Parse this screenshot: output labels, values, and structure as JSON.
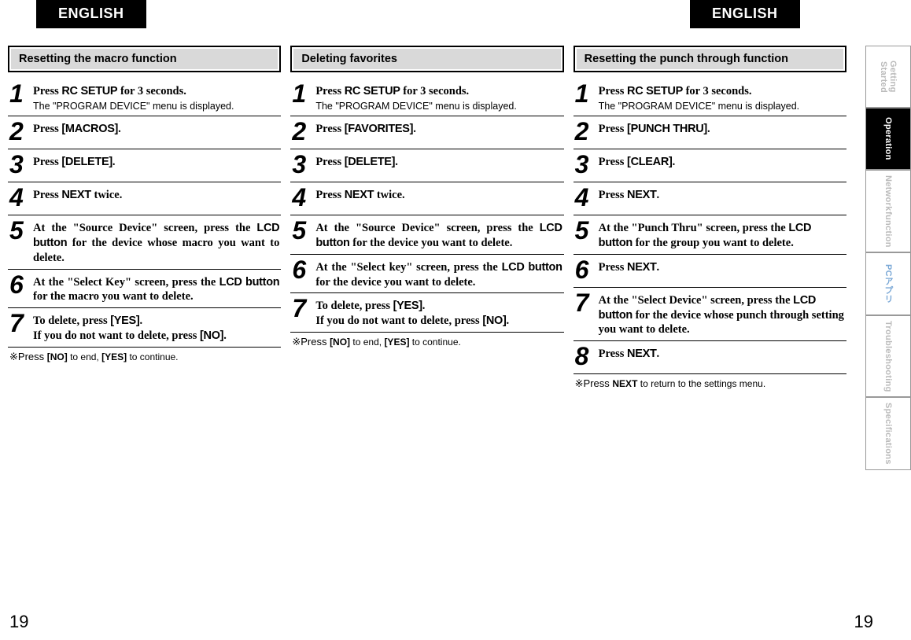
{
  "lang_left": "ENGLISH",
  "lang_right": "ENGLISH",
  "page_num_left": "19",
  "page_num_right": "19",
  "side_tabs": {
    "t0": "Getting Started",
    "t1": "Operation",
    "t2a": "Network",
    "t2b": "function",
    "t3": "PCアプリ",
    "t4": "Troubleshooting",
    "t5": "Specifications"
  },
  "col1": {
    "title": "Resetting the macro function",
    "s1_main_a": "Press ",
    "s1_main_b": "RC SETUP",
    "s1_main_c": " for 3 seconds.",
    "s1_sub": "The \"PROGRAM DEVICE\" menu is displayed.",
    "s2_main_a": "Press ",
    "s2_main_b": "[MACROS]",
    "s2_main_c": ".",
    "s3_main_a": "Press ",
    "s3_main_b": "[DELETE]",
    "s3_main_c": ".",
    "s4_main_a": "Press ",
    "s4_main_b": "NEXT",
    "s4_main_c": " twice.",
    "s5_main_a": "At the \"Source Device\" screen, press the ",
    "s5_main_b": "LCD button",
    "s5_main_c": " for the device whose macro you want to delete.",
    "s6_main_a": "At the \"Select Key\" screen, press the ",
    "s6_main_b": "LCD button",
    "s6_main_c": " for the macro you want to delete.",
    "s7_main_a": "To delete, press ",
    "s7_main_b": "[YES]",
    "s7_main_c": ".",
    "s7_main_d": "If you do not want to delete, press ",
    "s7_main_e": "[NO]",
    "s7_main_f": ".",
    "note_a": "※Press ",
    "note_b": "[NO]",
    "note_c": " to end, ",
    "note_d": "[YES]",
    "note_e": " to continue."
  },
  "col2": {
    "title": "Deleting favorites",
    "s1_main_a": "Press ",
    "s1_main_b": "RC SETUP",
    "s1_main_c": " for 3 seconds.",
    "s1_sub": "The \"PROGRAM DEVICE\" menu is displayed.",
    "s2_main_a": "Press ",
    "s2_main_b": "[FAVORITES]",
    "s2_main_c": ".",
    "s3_main_a": "Press ",
    "s3_main_b": "[DELETE]",
    "s3_main_c": ".",
    "s4_main_a": "Press ",
    "s4_main_b": "NEXT",
    "s4_main_c": " twice.",
    "s5_main_a": "At the \"Source Device\" screen, press the ",
    "s5_main_b": "LCD button",
    "s5_main_c": " for the device you want to delete.",
    "s6_main_a": "At the \"Select key\" screen, press the ",
    "s6_main_b": "LCD button",
    "s6_main_c": " for the device you want to delete.",
    "s7_main_a": "To delete, press ",
    "s7_main_b": "[YES]",
    "s7_main_c": ".",
    "s7_main_d": "If you do not want to delete, press ",
    "s7_main_e": "[NO]",
    "s7_main_f": ".",
    "note_a": "※Press ",
    "note_b": "[NO]",
    "note_c": " to end, ",
    "note_d": "[YES]",
    "note_e": " to continue."
  },
  "col3": {
    "title": "Resetting the punch through function",
    "s1_main_a": "Press ",
    "s1_main_b": "RC SETUP",
    "s1_main_c": " for 3 seconds.",
    "s1_sub": "The \"PROGRAM DEVICE\" menu is displayed.",
    "s2_main_a": "Press ",
    "s2_main_b": "[PUNCH THRU]",
    "s2_main_c": ".",
    "s3_main_a": "Press ",
    "s3_main_b": "[CLEAR]",
    "s3_main_c": ".",
    "s4_main_a": "Press ",
    "s4_main_b": "NEXT",
    "s4_main_c": ".",
    "s5_main_a": "At the \"Punch Thru\" screen, press the ",
    "s5_main_b": "LCD button",
    "s5_main_c": " for the group you want to delete.",
    "s6_main_a": "Press ",
    "s6_main_b": "NEXT",
    "s6_main_c": ".",
    "s7_main_a": "At the \"Select Device\" screen, press the ",
    "s7_main_b": "LCD button",
    "s7_main_c": " for the device whose punch through setting you want to delete.",
    "s8_main_a": "Press ",
    "s8_main_b": "NEXT",
    "s8_main_c": ".",
    "note_a": "※Press ",
    "note_b": "NEXT",
    "note_c": " to return to the settings menu."
  },
  "nums": {
    "n1": "1",
    "n2": "2",
    "n3": "3",
    "n4": "4",
    "n5": "5",
    "n6": "6",
    "n7": "7",
    "n8": "8"
  }
}
